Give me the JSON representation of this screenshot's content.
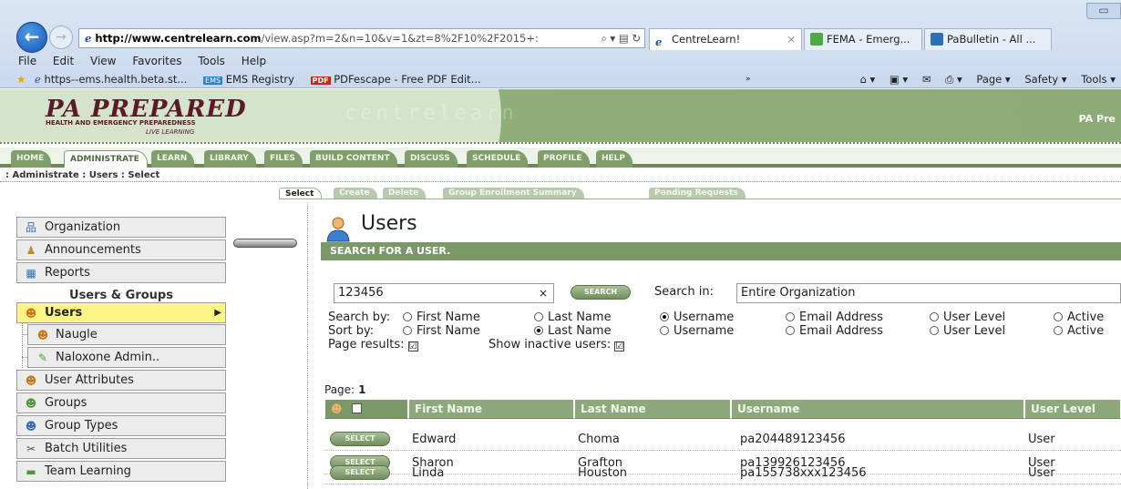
{
  "browser": {
    "address": {
      "host": "http://www.centrelearn.com",
      "rest": "/view.asp?m=2&n=10&v=1&zt=8%2F10%2F2015+:",
      "icons": "⌕ ▾ ▤ ↻"
    },
    "tabs": [
      {
        "label": "CentreLearn!",
        "close": "×"
      },
      {
        "label": "FEMA - Emerg..."
      },
      {
        "label": "PaBulletin - All ..."
      }
    ],
    "window_ctrl": "▭",
    "menu": [
      "File",
      "Edit",
      "View",
      "Favorites",
      "Tools",
      "Help"
    ],
    "favorites": [
      {
        "label": "https--ems.health.beta.st..."
      },
      {
        "label": "EMS Registry",
        "badge": "EMS"
      },
      {
        "label": "PDFescape - Free PDF Edit...",
        "badge": "PDF"
      }
    ],
    "overflow": "»",
    "commands": [
      "⌂ ▾",
      "▣ ▾",
      "✉",
      "⎙ ▾",
      "Page ▾",
      "Safety ▾",
      "Tools ▾"
    ]
  },
  "site": {
    "logo_main": "PA PREPARED",
    "logo_sub": "HEALTH AND EMERGENCY PREPAREDNESS",
    "logo_tag": "LIVE LEARNING",
    "watermark": "centrelearn",
    "header_right": "PA Pre"
  },
  "nav": [
    "HOME",
    "ADMINISTRATE",
    "LEARN",
    "LIBRARY",
    "FILES",
    "BUILD CONTENT",
    "DISCUSS",
    "SCHEDULE",
    "PROFILE",
    "HELP"
  ],
  "breadcrumb": ": Administrate  : Users : Select",
  "subtabs": [
    "Select",
    "Create",
    "Delete",
    "Group Enrollment Summary",
    "Pending Requests"
  ],
  "sidebar": {
    "items_top": [
      {
        "label": "Organization",
        "icon": "org-chart-icon",
        "glyph": "品"
      },
      {
        "label": "Announcements",
        "icon": "announcement-icon",
        "glyph": "♟"
      },
      {
        "label": "Reports",
        "icon": "reports-icon",
        "glyph": "▦"
      }
    ],
    "heading": "Users & Groups",
    "users": {
      "label": "Users",
      "glyph": "☻",
      "arrow": "▶"
    },
    "sub_items": [
      {
        "label": "Naugle",
        "glyph": "☻"
      },
      {
        "label": "Naloxone Admin..",
        "glyph": "✎"
      }
    ],
    "items_bottom": [
      {
        "label": "User Attributes",
        "glyph": "☻"
      },
      {
        "label": "Groups",
        "glyph": "☻"
      },
      {
        "label": "Group Types",
        "glyph": "☻"
      },
      {
        "label": "Batch Utilities",
        "glyph": "✂"
      },
      {
        "label": "Team Learning",
        "glyph": "▬"
      }
    ]
  },
  "main": {
    "title": "Users",
    "bar": "SEARCH FOR A USER.",
    "search_value": "123456",
    "clear": "×",
    "search_button": "SEARCH",
    "search_in_label": "Search in:",
    "search_in_value": "Entire Organization",
    "search_by_label": "Search by:",
    "sort_by_label": "Sort by:",
    "search_by_options": [
      "First Name",
      "Last Name",
      "Username",
      "Email Address",
      "User Level",
      "Active"
    ],
    "search_by_selected": 2,
    "sort_by_options": [
      "First Name",
      "Last Name",
      "Username",
      "Email Address",
      "User Level",
      "Active"
    ],
    "sort_by_selected": 1,
    "page_results_label": "Page results:",
    "page_results_checked": "☑",
    "show_inactive_label": "Show inactive users:",
    "show_inactive_checked": "☑",
    "page_label": "Page:",
    "page_number": "1",
    "columns": [
      "First Name",
      "Last Name",
      "Username",
      "User Level"
    ],
    "select_label": "SELECT",
    "rows": [
      {
        "first": "Edward",
        "last": "Choma",
        "username": "pa204489123456",
        "level": "User"
      },
      {
        "first": "Sharon",
        "last": "Grafton",
        "username": "pa139926123456",
        "level": "User"
      },
      {
        "first": "Linda",
        "last": "Houston",
        "username": "pa155738xxx123456",
        "level": "User"
      }
    ]
  },
  "colors": {
    "brand_green": "#7b9967",
    "active_yellow": "#fff585",
    "logo_maroon": "#5a1a2a"
  }
}
